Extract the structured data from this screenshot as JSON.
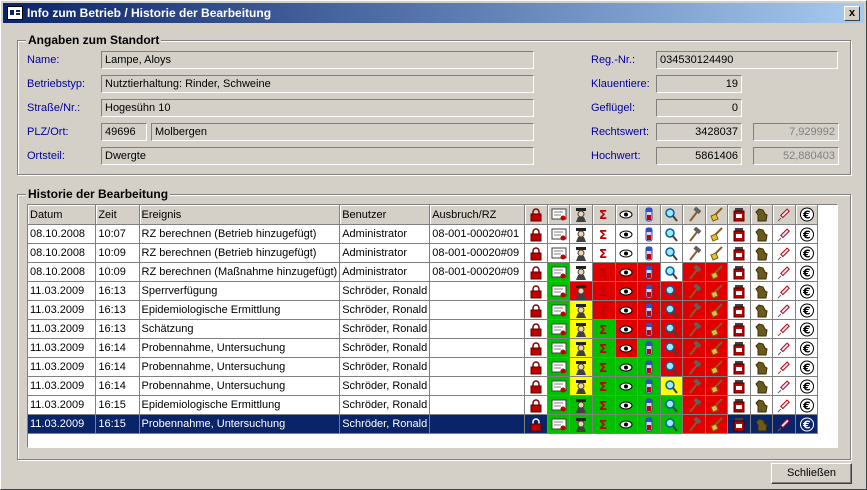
{
  "window": {
    "title": "Info zum Betrieb / Historie der Bearbeitung",
    "close_glyph": "x"
  },
  "standort": {
    "group_title": "Angaben zum Standort",
    "name_label": "Name:",
    "name": "Lampe, Aloys",
    "betriebstyp_label": "Betriebstyp:",
    "betriebstyp": "Nutztierhaltung: Rinder, Schweine",
    "strasse_label": "Straße/Nr.:",
    "strasse": "Hogesühn 10",
    "plzort_label": "PLZ/Ort:",
    "plz": "49696",
    "ort": "Molbergen",
    "ortsteil_label": "Ortsteil:",
    "ortsteil": "Dwergte",
    "regnr_label": "Reg.-Nr.:",
    "regnr": "034530124490",
    "klauentiere_label": "Klauentiere:",
    "klauentiere": "19",
    "gefluegel_label": "Geflügel:",
    "gefluegel": "0",
    "rechtswert_label": "Rechtswert:",
    "rechtswert": "3428037",
    "rechtswert_deg": "7,929992",
    "hochwert_label": "Hochwert:",
    "hochwert": "5861406",
    "hochwert_deg": "52,880403"
  },
  "historie": {
    "group_title": "Historie der Bearbeitung",
    "columns": [
      "Datum",
      "Zeit",
      "Ereignis",
      "Benutzer",
      "Ausbruch/RZ"
    ],
    "icon_columns": [
      "lock-icon",
      "certificate-icon",
      "inspector-icon",
      "sigma-icon",
      "eye-icon",
      "vial-icon",
      "magnifier-icon",
      "hammer-icon",
      "broom-icon",
      "jar-icon",
      "animal-icon",
      "syringe-icon",
      "euro-icon"
    ],
    "rows": [
      {
        "datum": "08.10.2008",
        "zeit": "10:07",
        "ereignis": "RZ berechnen (Betrieb hinzugefügt)",
        "benutzer": "Administrator",
        "ausbruch": "08-001-00020#01",
        "colors": [
          "w",
          "w",
          "w",
          "w",
          "w",
          "w",
          "w",
          "w",
          "w",
          "w",
          "w",
          "w",
          "w"
        ]
      },
      {
        "datum": "08.10.2008",
        "zeit": "10:09",
        "ereignis": "RZ berechnen (Betrieb hinzugefügt)",
        "benutzer": "Administrator",
        "ausbruch": "08-001-00020#09",
        "colors": [
          "w",
          "w",
          "w",
          "w",
          "w",
          "w",
          "w",
          "w",
          "w",
          "w",
          "w",
          "w",
          "w"
        ]
      },
      {
        "datum": "08.10.2008",
        "zeit": "10:09",
        "ereignis": "RZ berechnen (Maßnahme hinzugefügt)",
        "benutzer": "Administrator",
        "ausbruch": "08-001-00020#09",
        "colors": [
          "w",
          "g",
          "w",
          "r",
          "r",
          "r",
          "w",
          "r",
          "r",
          "w",
          "w",
          "w",
          "w"
        ]
      },
      {
        "datum": "11.03.2009",
        "zeit": "16:13",
        "ereignis": "Sperrverfügung",
        "benutzer": "Schröder, Ronald",
        "ausbruch": "",
        "colors": [
          "w",
          "g",
          "r",
          "r",
          "r",
          "r",
          "r",
          "r",
          "r",
          "w",
          "w",
          "w",
          "w"
        ]
      },
      {
        "datum": "11.03.2009",
        "zeit": "16:13",
        "ereignis": "Epidemiologische Ermittlung",
        "benutzer": "Schröder, Ronald",
        "ausbruch": "",
        "colors": [
          "w",
          "g",
          "y",
          "r",
          "r",
          "r",
          "r",
          "r",
          "r",
          "w",
          "w",
          "w",
          "w"
        ]
      },
      {
        "datum": "11.03.2009",
        "zeit": "16:13",
        "ereignis": "Schätzung",
        "benutzer": "Schröder, Ronald",
        "ausbruch": "",
        "colors": [
          "w",
          "g",
          "y",
          "g",
          "r",
          "r",
          "r",
          "r",
          "r",
          "w",
          "w",
          "w",
          "w"
        ]
      },
      {
        "datum": "11.03.2009",
        "zeit": "16:14",
        "ereignis": "Probennahme, Untersuchung",
        "benutzer": "Schröder, Ronald",
        "ausbruch": "",
        "colors": [
          "w",
          "g",
          "y",
          "g",
          "r",
          "g",
          "r",
          "r",
          "r",
          "w",
          "w",
          "w",
          "w"
        ]
      },
      {
        "datum": "11.03.2009",
        "zeit": "16:14",
        "ereignis": "Probennahme, Untersuchung",
        "benutzer": "Schröder, Ronald",
        "ausbruch": "",
        "colors": [
          "w",
          "g",
          "y",
          "g",
          "g",
          "g",
          "r",
          "r",
          "r",
          "w",
          "w",
          "w",
          "w"
        ]
      },
      {
        "datum": "11.03.2009",
        "zeit": "16:14",
        "ereignis": "Probennahme, Untersuchung",
        "benutzer": "Schröder, Ronald",
        "ausbruch": "",
        "colors": [
          "w",
          "g",
          "y",
          "g",
          "g",
          "g",
          "y",
          "r",
          "r",
          "w",
          "w",
          "w",
          "w"
        ]
      },
      {
        "datum": "11.03.2009",
        "zeit": "16:15",
        "ereignis": "Epidemiologische Ermittlung",
        "benutzer": "Schröder, Ronald",
        "ausbruch": "",
        "colors": [
          "w",
          "g",
          "g",
          "g",
          "g",
          "g",
          "g",
          "r",
          "r",
          "w",
          "w",
          "w",
          "w"
        ]
      },
      {
        "datum": "11.03.2009",
        "zeit": "16:15",
        "ereignis": "Probennahme, Untersuchung",
        "benutzer": "Schröder, Ronald",
        "ausbruch": "",
        "colors": [
          "s",
          "g",
          "g",
          "g",
          "g",
          "g",
          "g",
          "r",
          "r",
          "s",
          "s",
          "s",
          "s"
        ],
        "selected": true
      }
    ]
  },
  "colors": {
    "w": "#ffffff",
    "g": "#00c000",
    "r": "#e00000",
    "y": "#ffff00",
    "s": "#0a246a"
  },
  "buttons": {
    "close_label": "Schließen"
  }
}
